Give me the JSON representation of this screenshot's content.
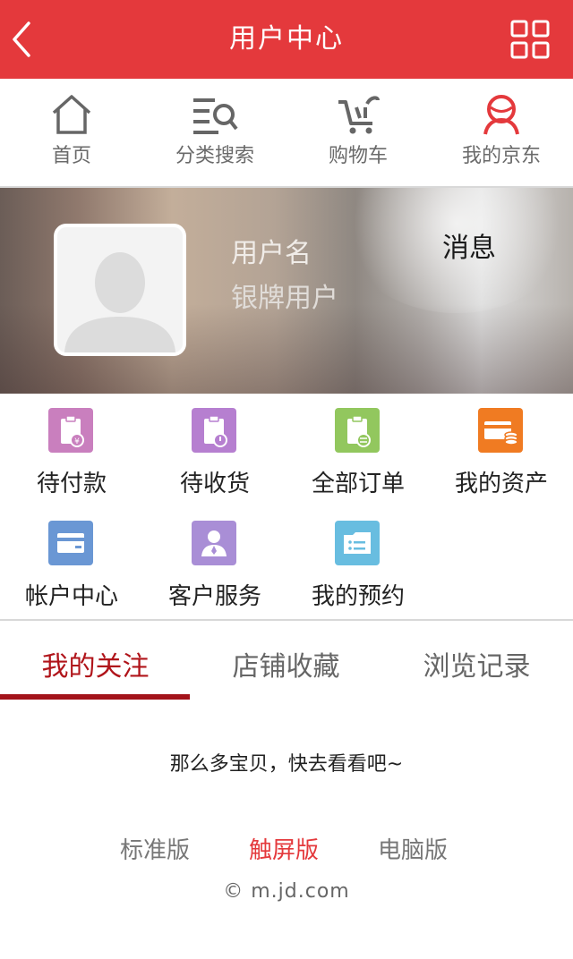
{
  "header": {
    "title": "用户中心",
    "back_icon": "chevron-left-icon",
    "menu_icon": "grid-icon"
  },
  "nav": {
    "items": [
      {
        "label": "首页",
        "icon": "home-icon"
      },
      {
        "label": "分类搜索",
        "icon": "category-search-icon"
      },
      {
        "label": "购物车",
        "icon": "cart-icon"
      },
      {
        "label": "我的京东",
        "icon": "user-icon"
      }
    ]
  },
  "profile": {
    "username": "用户名",
    "level": "银牌用户",
    "message_label": "消息",
    "avatar_icon": "avatar-placeholder-icon"
  },
  "orders": {
    "items": [
      {
        "label": "待付款",
        "icon": "pending-payment-icon",
        "color": "#c97fbe"
      },
      {
        "label": "待收货",
        "icon": "pending-receipt-icon",
        "color": "#b67fd0"
      },
      {
        "label": "全部订单",
        "icon": "all-orders-icon",
        "color": "#92c75e"
      },
      {
        "label": "我的资产",
        "icon": "wallet-icon",
        "color": "#f07b22"
      },
      {
        "label": "帐户中心",
        "icon": "card-icon",
        "color": "#6a97d4"
      },
      {
        "label": "客户服务",
        "icon": "service-agent-icon",
        "color": "#a98ed6"
      },
      {
        "label": "我的预约",
        "icon": "reservation-icon",
        "color": "#68bde0"
      }
    ]
  },
  "tabs": {
    "items": [
      {
        "label": "我的关注",
        "active": true
      },
      {
        "label": "店铺收藏",
        "active": false
      },
      {
        "label": "浏览记录",
        "active": false
      }
    ]
  },
  "empty_text": "那么多宝贝，快去看看吧~",
  "versions": {
    "items": [
      {
        "label": "标准版",
        "active": false
      },
      {
        "label": "触屏版",
        "active": true
      },
      {
        "label": "电脑版",
        "active": false
      }
    ]
  },
  "footer": {
    "copyright": "© m.jd.com"
  },
  "colors": {
    "brand_red": "#e4393c",
    "tab_active": "#b0141a"
  }
}
